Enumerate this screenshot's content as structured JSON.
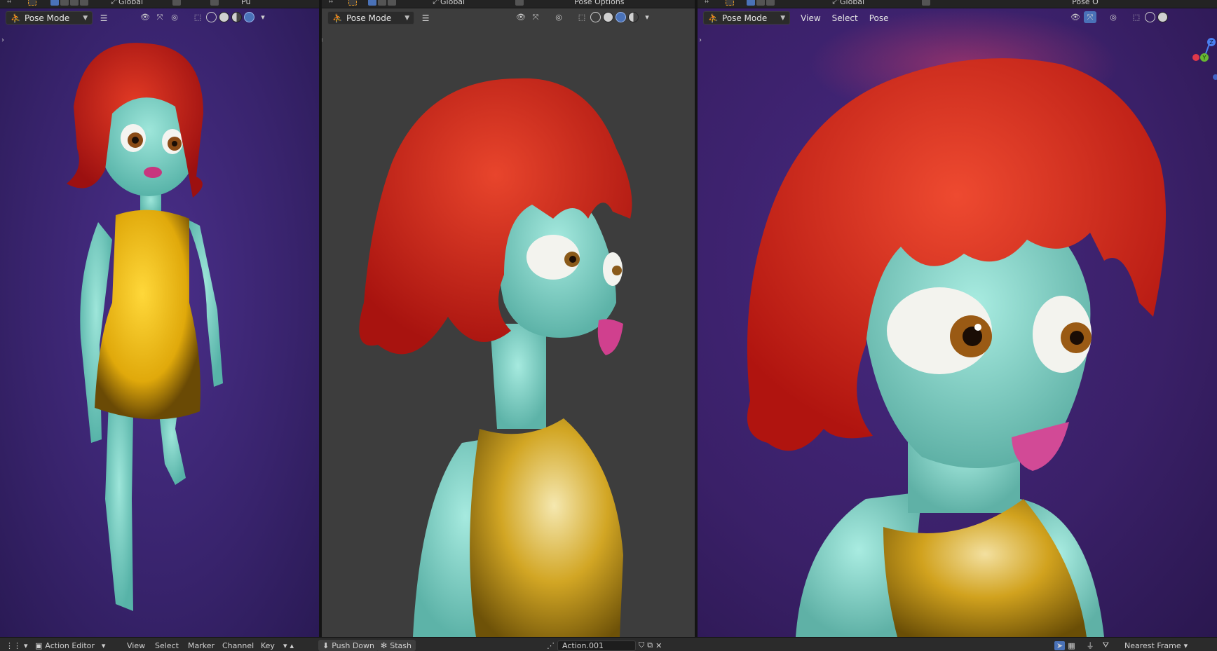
{
  "colors": {
    "skin": "#7fd3c6",
    "hair": "#d6201a",
    "dress": "#e9b80f",
    "purple_bg": "#3a2370",
    "grey_bg": "#3d3d3d",
    "header_bg": "#232323"
  },
  "top_strip": {
    "left": {
      "orientation": "Global"
    },
    "mid": {
      "orientation": "Global",
      "right_label": "Pose Options"
    },
    "right": {
      "orientation": "Global",
      "right_label": "Pose O"
    },
    "cut_left_label": "Pu"
  },
  "viewports": {
    "left": {
      "mode": "Pose Mode"
    },
    "mid": {
      "mode": "Pose Mode"
    },
    "right": {
      "mode": "Pose Mode",
      "menus": [
        "View",
        "Select",
        "Pose"
      ],
      "gizmo": {
        "z_label": "Z",
        "y_label": "Y"
      }
    }
  },
  "bottom_bar": {
    "editor": "Action Editor",
    "menus": [
      "View",
      "Select",
      "Marker",
      "Channel",
      "Key"
    ],
    "push_down": "Push Down",
    "stash": "Stash",
    "action_name": "Action.001",
    "snap": "Nearest Frame"
  }
}
